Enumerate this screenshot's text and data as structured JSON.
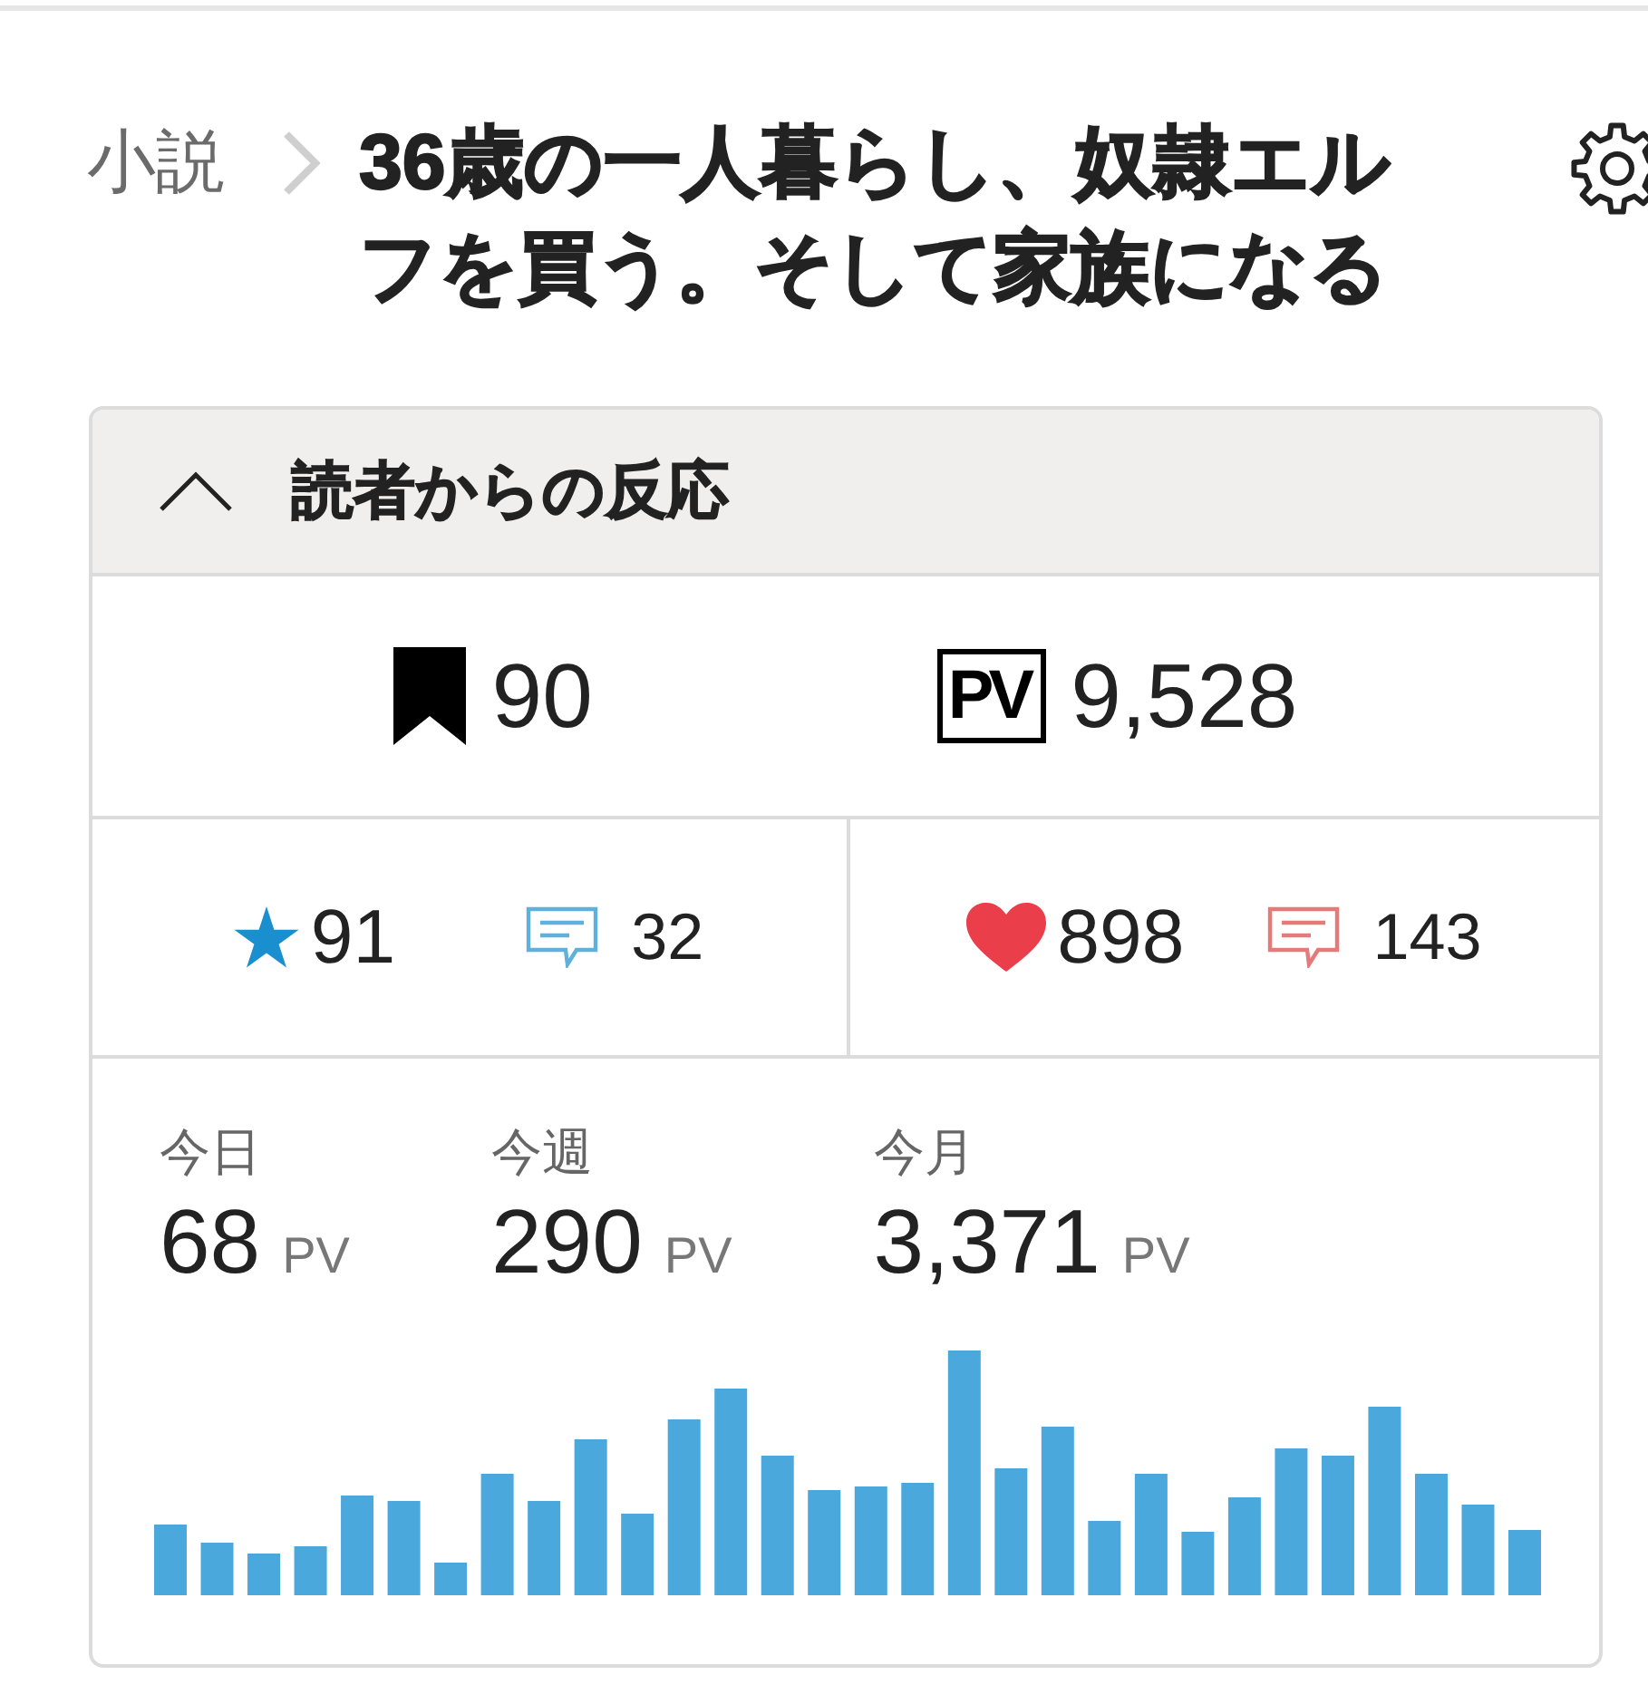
{
  "breadcrumb": {
    "category": "小説",
    "title": "36歳の一人暮らし、奴隷エルフを買う。そして家族になる"
  },
  "reactions": {
    "title": "読者からの反応",
    "expanded": true,
    "totals": [
      {
        "kind": "bookmark",
        "value": "90"
      },
      {
        "kind": "pv",
        "icon_text": "PV",
        "value": "9,528"
      }
    ],
    "groups": [
      {
        "items": [
          {
            "kind": "star",
            "color": "#1a8fd0",
            "value": "91"
          },
          {
            "kind": "comment",
            "color": "#5fb0da",
            "value": "32"
          }
        ]
      },
      {
        "items": [
          {
            "kind": "heart",
            "color": "#ea3f4b",
            "value": "898"
          },
          {
            "kind": "comment",
            "color": "#e57a7a",
            "value": "143"
          }
        ]
      }
    ],
    "periods": [
      {
        "label": "今日",
        "value": "68",
        "unit": "PV"
      },
      {
        "label": "今週",
        "value": "290",
        "unit": "PV"
      },
      {
        "label": "今月",
        "value": "3,371",
        "unit": "PV"
      }
    ]
  }
}
